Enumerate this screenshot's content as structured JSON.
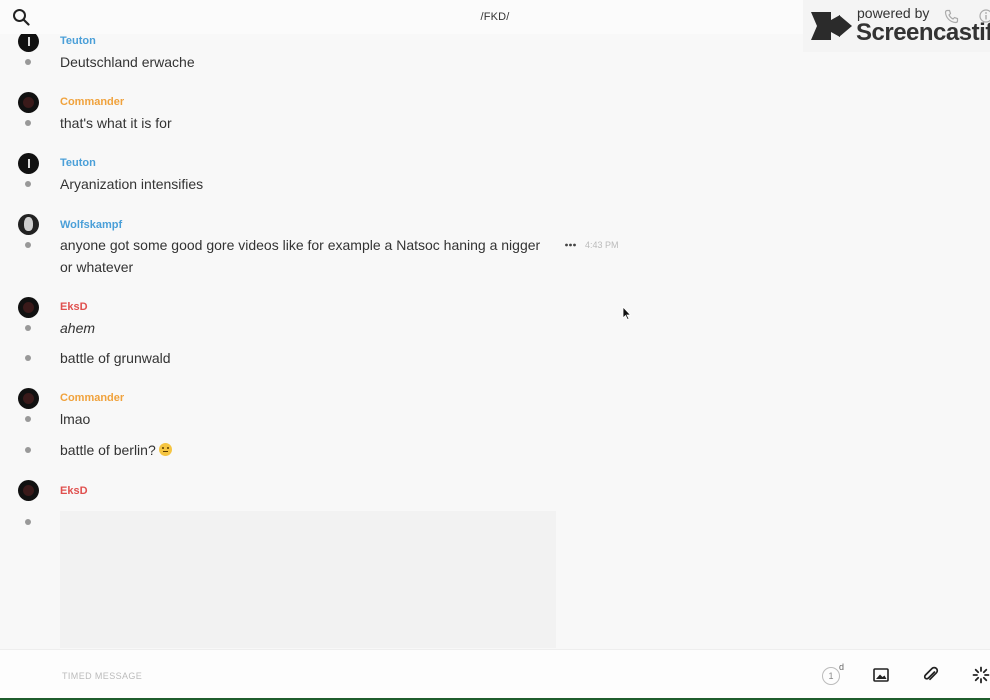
{
  "header": {
    "channel_title": "/FKD/"
  },
  "watermark": {
    "powered_by": "powered by",
    "brand": "Screencastify"
  },
  "messages": [
    {
      "author": "Teuton",
      "lines": [
        "Deutschland erwache"
      ]
    },
    {
      "author": "Commander",
      "lines": [
        "that's what it is for"
      ]
    },
    {
      "author": "Teuton",
      "lines": [
        "Aryanization intensifies"
      ]
    },
    {
      "author": "Wolfskampf",
      "lines": [
        "anyone got some good gore videos like for example a Natsoc haning a nigger or whatever"
      ],
      "timestamp": "4:43 PM"
    },
    {
      "author": "EksD",
      "lines": [
        "ahem",
        "battle of grunwald"
      ]
    },
    {
      "author": "Commander",
      "lines": [
        "lmao",
        "battle of berlin?"
      ]
    },
    {
      "author": "EksD",
      "lines": []
    }
  ],
  "composer": {
    "placeholder": "TIMED MESSAGE",
    "timer_value": "1",
    "timer_unit": "d"
  },
  "colors": {
    "author_blue": "#4a9fd8",
    "author_orange": "#f0a23c",
    "author_red": "#e0504e",
    "background": "#f8f8f8"
  },
  "icons": [
    "search-icon",
    "more-icon",
    "image-icon",
    "paperclip-icon",
    "loading-icon",
    "phone-icon",
    "info-icon"
  ]
}
